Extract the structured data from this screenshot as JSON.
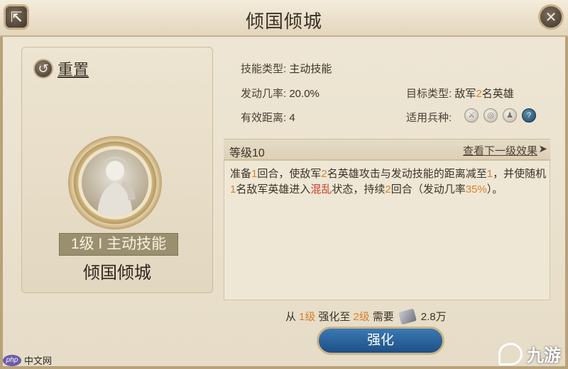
{
  "window": {
    "title": "倾国倾城"
  },
  "left": {
    "reset_label": "重置",
    "level_badge": "1级 I 主动技能",
    "skill_name": "倾国倾城"
  },
  "info": {
    "skill_type_key": "技能类型:",
    "skill_type_val": "主动技能",
    "rate_key": "发动几率:",
    "rate_val": "20.0%",
    "target_key": "目标类型:",
    "target_pre": "敌军",
    "target_num": "2",
    "target_post": "名英雄",
    "range_key": "有效距离:",
    "range_val": "4",
    "troop_key": "适用兵种:",
    "troop_icons": [
      "sword-icon",
      "shield-icon",
      "bell-icon",
      "question-icon"
    ]
  },
  "level_bar": {
    "level_label": "等级10",
    "next_link": "查看下一级效果",
    "arrow": "➤"
  },
  "description": {
    "p1": "准备",
    "n1": "1",
    "p2": "回合，使敌军",
    "n2": "2",
    "p3": "名英雄攻击与发动技能的距离减至",
    "n3": "1",
    "p4": "，并使随机",
    "n4": "1",
    "p5": "名敌军英雄进入",
    "status": "混乱",
    "p6": "状态，持续",
    "n5": "2",
    "p7": "回合（发动几率",
    "n6": "35%",
    "p8": "）。"
  },
  "upgrade": {
    "from_pre": "从",
    "from_level": "1级",
    "to_pre": "强化至",
    "to_level": "2级",
    "need": "需要",
    "cost_amount": "2.8",
    "cost_unit": "万",
    "button_label": "强化"
  },
  "watermarks": {
    "left_badge": "php",
    "left_text": "中文网",
    "right_text": "九游"
  },
  "colors": {
    "highlight_number": "#d6822e",
    "status_red": "#c53d2a",
    "button_blue": "#1d4f86"
  }
}
